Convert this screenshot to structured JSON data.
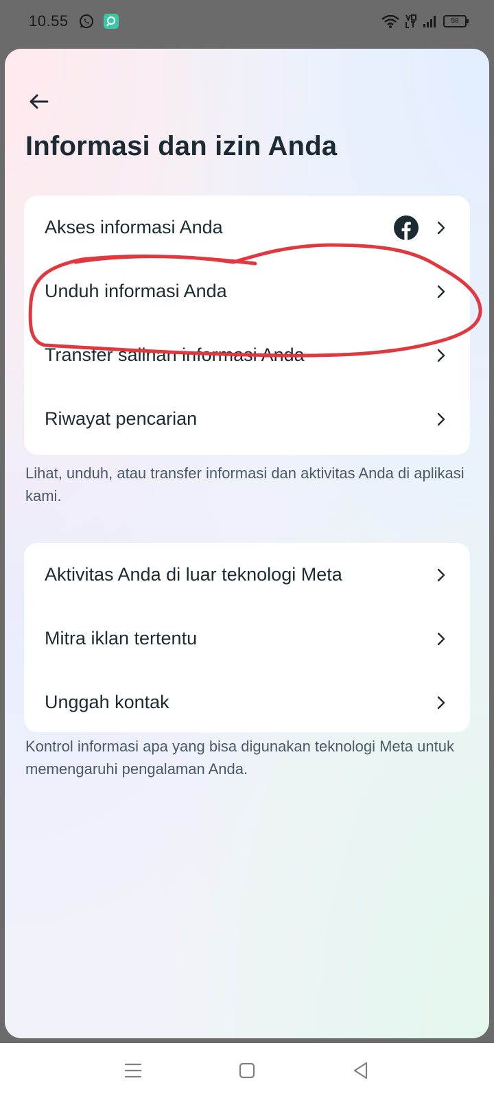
{
  "status_bar": {
    "time": "10.55",
    "app_icons": [
      "whatsapp-icon",
      "app-notification-icon"
    ],
    "indicators": [
      "wifi-icon",
      "volte-icon",
      "signal-icon",
      "battery-icon"
    ],
    "battery_level": "58"
  },
  "header": {
    "back_icon": "arrow-left-icon",
    "title": "Informasi dan izin Anda"
  },
  "section1": {
    "items": [
      {
        "label": "Akses informasi Anda",
        "icon": "facebook-icon"
      },
      {
        "label": "Unduh informasi Anda"
      },
      {
        "label": "Transfer salinan informasi Anda"
      },
      {
        "label": "Riwayat pencarian"
      }
    ],
    "caption": "Lihat, unduh, atau transfer informasi dan aktivitas Anda di aplikasi kami."
  },
  "section2": {
    "items": [
      {
        "label": "Aktivitas Anda di luar teknologi Meta"
      },
      {
        "label": "Mitra iklan tertentu"
      },
      {
        "label": "Unggah kontak"
      }
    ],
    "caption": "Kontrol informasi apa yang bisa digunakan teknologi Meta untuk memengaruhi pengalaman Anda."
  },
  "annotation": {
    "shape": "hand-drawn-circle",
    "color": "#e0383e",
    "target": "Unduh informasi Anda"
  },
  "nav_bar": {
    "buttons": [
      "recent-apps-icon",
      "home-icon",
      "back-triangle-icon"
    ]
  },
  "colors": {
    "accent_text": "#1c2b33",
    "annotation": "#e0383e",
    "facebook": "#1c2b33"
  }
}
